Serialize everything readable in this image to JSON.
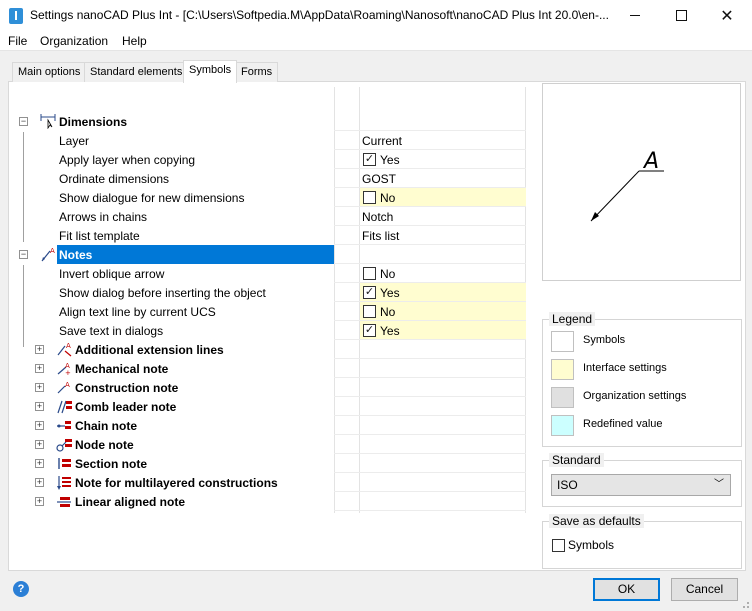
{
  "window": {
    "title": "Settings nanoCAD Plus Int - [C:\\Users\\Softpedia.M\\AppData\\Roaming\\Nanosoft\\nanoCAD Plus Int 20.0\\en-..."
  },
  "menu": [
    "File",
    "Organization",
    "Help"
  ],
  "tabs": [
    "Main options",
    "Standard elements",
    "Symbols",
    "Forms"
  ],
  "tree": {
    "dimensions": {
      "label": "Dimensions",
      "props": [
        {
          "label": "Layer",
          "value": "Current"
        },
        {
          "label": "Apply layer when copying",
          "value": "Yes",
          "checked": true
        },
        {
          "label": "Ordinate dimensions",
          "value": "GOST"
        },
        {
          "label": "Show dialogue for new dimensions",
          "value": "No",
          "checked": false
        },
        {
          "label": "Arrows in chains",
          "value": "Notch"
        },
        {
          "label": "Fit list template",
          "value": "Fits list"
        }
      ]
    },
    "notes": {
      "label": "Notes",
      "props": [
        {
          "label": "Invert oblique arrow",
          "value": "No",
          "checked": false
        },
        {
          "label": "Show dialog before inserting the object",
          "value": "Yes",
          "checked": true
        },
        {
          "label": "Align text line by current UCS",
          "value": "No",
          "checked": false
        },
        {
          "label": "Save text in dialogs",
          "value": "Yes",
          "checked": true
        }
      ]
    },
    "children": [
      "Additional extension lines",
      "Mechanical note",
      "Construction note",
      "Comb leader note",
      "Chain note",
      "Node note",
      "Section note",
      "Note for multilayered constructions",
      "Linear aligned note"
    ]
  },
  "preview": {
    "symbol_letter": "A"
  },
  "legend": {
    "title": "Legend",
    "items": [
      {
        "label": "Symbols",
        "color": "#ffffff"
      },
      {
        "label": "Interface settings",
        "color": "#fffdd0"
      },
      {
        "label": "Organization settings",
        "color": "#e0e0e0"
      },
      {
        "label": "Redefined value",
        "color": "#ccffff"
      }
    ]
  },
  "standard": {
    "title": "Standard",
    "selected": "ISO"
  },
  "save_defaults": {
    "title": "Save as defaults",
    "checkbox_label": "Symbols"
  },
  "buttons": {
    "ok": "OK",
    "cancel": "Cancel"
  },
  "colors": {
    "accent": "#0078d7",
    "interface_highlight": "#fffdd0"
  }
}
